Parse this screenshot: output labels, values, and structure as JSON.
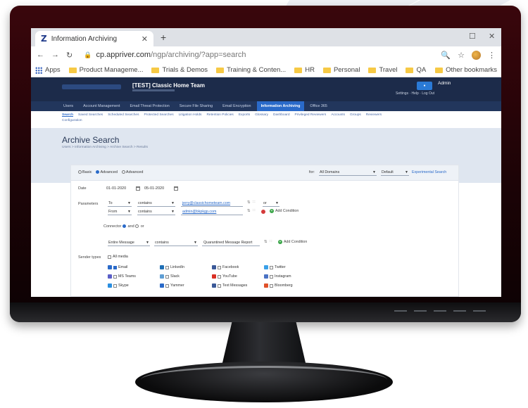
{
  "browser": {
    "tab_title": "Information Archiving",
    "new_tab_symbol": "+",
    "url_domain": "cp.appriver.com",
    "url_path": "/ngp/archiving/?app=search",
    "bookmarks": [
      {
        "label": "Apps"
      },
      {
        "label": "Product Manageme..."
      },
      {
        "label": "Trials & Demos"
      },
      {
        "label": "Training & Conten..."
      },
      {
        "label": "HR"
      },
      {
        "label": "Personal"
      },
      {
        "label": "Travel"
      },
      {
        "label": "QA"
      }
    ],
    "other_bookmarks": "Other bookmarks"
  },
  "app": {
    "company": "[TEST] Classic Home Team",
    "admin_label": "Admin",
    "header_links": "Settings  ·  Help  ·  Log Out",
    "main_nav": [
      {
        "label": "Users"
      },
      {
        "label": "Account Management"
      },
      {
        "label": "Email Threat Protection"
      },
      {
        "label": "Secure File Sharing"
      },
      {
        "label": "Email Encryption"
      },
      {
        "label": "Information Archiving"
      },
      {
        "label": "Office 365"
      }
    ],
    "sub_nav": [
      {
        "label": "Search"
      },
      {
        "label": "Saved Searches"
      },
      {
        "label": "Scheduled Searches"
      },
      {
        "label": "Protected Searches"
      },
      {
        "label": "Litigation Holds"
      },
      {
        "label": "Retention Policies"
      },
      {
        "label": "Exports"
      },
      {
        "label": "Glossary"
      },
      {
        "label": "Dashboard"
      },
      {
        "label": "Privileged Reviewers"
      },
      {
        "label": "Accounts"
      },
      {
        "label": "Groups"
      },
      {
        "label": "Reviewers"
      }
    ],
    "sub_nav_second": "Configuration",
    "page_title": "Archive Search",
    "breadcrumb": "Users > Information Archiving > Archive Search > Results",
    "search": {
      "modes": [
        "Basic",
        "Advanced",
        "Advanced"
      ],
      "for_label": "for:",
      "domain_select": "All Domains",
      "default_select": "Default",
      "advanced_link": "Experimental Search",
      "date_label": "Date",
      "date_from": "01-01-2020",
      "date_to": "05-01-2020",
      "parameters_label": "Parameters",
      "rows": [
        {
          "field": "To",
          "op": "contains",
          "value": "jerry@classichometeam.com",
          "join": "or"
        },
        {
          "field": "From",
          "op": "contains",
          "value": "admin@bkpkgp.com",
          "add": "Add Condition"
        }
      ],
      "connector_label": "Connector",
      "connector_and": "and",
      "connector_or": "or",
      "group_field": "Entire Message",
      "group_op": "contains",
      "group_value": "Quarantined Message Report",
      "group_add": "Add Condition",
      "sender_types_label": "Sender types",
      "all_media": "All media",
      "sources": [
        {
          "label": "Email",
          "color": "#2a6ac9",
          "checked": true
        },
        {
          "label": "LinkedIn",
          "color": "#1f6fb5",
          "checked": false
        },
        {
          "label": "Facebook",
          "color": "#3b5998",
          "checked": false
        },
        {
          "label": "Twitter",
          "color": "#3aa0e8",
          "checked": false
        },
        {
          "label": "MS Teams",
          "color": "#5b5fc7",
          "checked": false
        },
        {
          "label": "Slack",
          "color": "#5f9ed4",
          "checked": false
        },
        {
          "label": "YouTube",
          "color": "#d93025",
          "checked": false
        },
        {
          "label": "Instagram",
          "color": "#4a72c4",
          "checked": false
        },
        {
          "label": "Skype",
          "color": "#2a8ee0",
          "checked": false
        },
        {
          "label": "Yammer",
          "color": "#2a6ac9",
          "checked": false
        },
        {
          "label": "Text Messages",
          "color": "#3b5998",
          "checked": false
        },
        {
          "label": "Bloomberg",
          "color": "#e0512a",
          "checked": false
        }
      ]
    }
  }
}
